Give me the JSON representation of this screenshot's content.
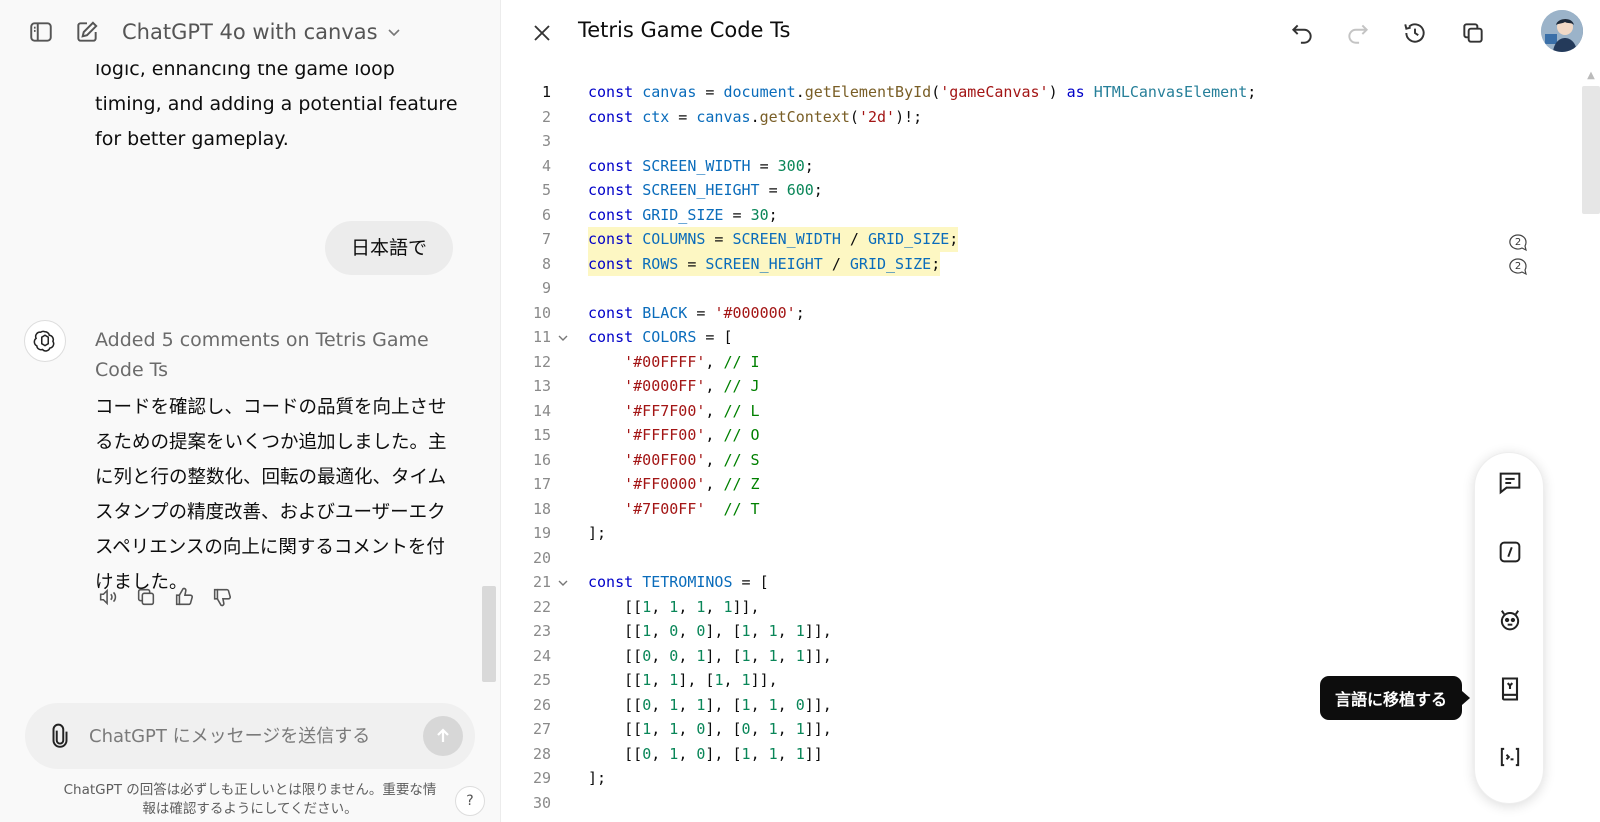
{
  "left_header": {
    "model_title": "ChatGPT 4o with canvas"
  },
  "conversation": {
    "previous_message_tail": "logic, enhancing the game loop timing, and adding a potential feature for better gameplay.",
    "user_message": "日本語で",
    "assistant_status": "Added 5 comments on Tetris Game Code Ts",
    "assistant_text": "コードを確認し、コードの品質を向上させるための提案をいくつか追加しました。主に列と行の整数化、回転の最適化、タイムスタンプの精度改善、およびユーザーエクスペリエンスの向上に関するコメントを付けました。"
  },
  "composer": {
    "placeholder": "ChatGPT にメッセージを送信する"
  },
  "disclaimer": "ChatGPT の回答は必ずしも正しいとは限りません。重要な情報は確認するようにしてください。",
  "help_label": "?",
  "canvas": {
    "title": "Tetris Game Code Ts",
    "comment_counts": [
      "2",
      "2"
    ],
    "tooltip": "言語に移植する"
  },
  "code_lines": [
    {
      "n": "1",
      "tokens": [
        [
          "kw",
          "const "
        ],
        [
          "var",
          "canvas"
        ],
        [
          "p",
          " = "
        ],
        [
          "var",
          "document"
        ],
        [
          "p",
          "."
        ],
        [
          "fn",
          "getElementById"
        ],
        [
          "p",
          "("
        ],
        [
          "str",
          "'gameCanvas'"
        ],
        [
          "p",
          ") "
        ],
        [
          "kw",
          "as "
        ],
        [
          "ty",
          "HTMLCanvasElement"
        ],
        [
          "p",
          ";"
        ]
      ]
    },
    {
      "n": "2",
      "tokens": [
        [
          "kw",
          "const "
        ],
        [
          "var",
          "ctx"
        ],
        [
          "p",
          " = "
        ],
        [
          "var",
          "canvas"
        ],
        [
          "p",
          "."
        ],
        [
          "fn",
          "getContext"
        ],
        [
          "p",
          "("
        ],
        [
          "str",
          "'2d'"
        ],
        [
          "p",
          ")!;"
        ]
      ]
    },
    {
      "n": "3",
      "tokens": []
    },
    {
      "n": "4",
      "tokens": [
        [
          "kw",
          "const "
        ],
        [
          "var",
          "SCREEN_WIDTH"
        ],
        [
          "p",
          " = "
        ],
        [
          "num",
          "300"
        ],
        [
          "p",
          ";"
        ]
      ]
    },
    {
      "n": "5",
      "tokens": [
        [
          "kw",
          "const "
        ],
        [
          "var",
          "SCREEN_HEIGHT"
        ],
        [
          "p",
          " = "
        ],
        [
          "num",
          "600"
        ],
        [
          "p",
          ";"
        ]
      ]
    },
    {
      "n": "6",
      "tokens": [
        [
          "kw",
          "const "
        ],
        [
          "var",
          "GRID_SIZE"
        ],
        [
          "p",
          " = "
        ],
        [
          "num",
          "30"
        ],
        [
          "p",
          ";"
        ]
      ]
    },
    {
      "n": "7",
      "hl": true,
      "tokens": [
        [
          "kw",
          "const "
        ],
        [
          "var",
          "COLUMNS"
        ],
        [
          "p",
          " = "
        ],
        [
          "var",
          "SCREEN_WIDTH"
        ],
        [
          "p",
          " / "
        ],
        [
          "var",
          "GRID_SIZE"
        ],
        [
          "p",
          ";"
        ]
      ]
    },
    {
      "n": "8",
      "hl": true,
      "tokens": [
        [
          "kw",
          "const "
        ],
        [
          "var",
          "ROWS"
        ],
        [
          "p",
          " = "
        ],
        [
          "var",
          "SCREEN_HEIGHT"
        ],
        [
          "p",
          " / "
        ],
        [
          "var",
          "GRID_SIZE"
        ],
        [
          "p",
          ";"
        ]
      ]
    },
    {
      "n": "9",
      "tokens": []
    },
    {
      "n": "10",
      "tokens": [
        [
          "kw",
          "const "
        ],
        [
          "var",
          "BLACK"
        ],
        [
          "p",
          " = "
        ],
        [
          "str",
          "'#000000'"
        ],
        [
          "p",
          ";"
        ]
      ]
    },
    {
      "n": "11",
      "fold": true,
      "tokens": [
        [
          "kw",
          "const "
        ],
        [
          "var",
          "COLORS"
        ],
        [
          "p",
          " = ["
        ]
      ]
    },
    {
      "n": "12",
      "tokens": [
        [
          "p",
          "    "
        ],
        [
          "str",
          "'#00FFFF'"
        ],
        [
          "p",
          ", "
        ],
        [
          "cm",
          "// I"
        ]
      ]
    },
    {
      "n": "13",
      "tokens": [
        [
          "p",
          "    "
        ],
        [
          "str",
          "'#0000FF'"
        ],
        [
          "p",
          ", "
        ],
        [
          "cm",
          "// J"
        ]
      ]
    },
    {
      "n": "14",
      "tokens": [
        [
          "p",
          "    "
        ],
        [
          "str",
          "'#FF7F00'"
        ],
        [
          "p",
          ", "
        ],
        [
          "cm",
          "// L"
        ]
      ]
    },
    {
      "n": "15",
      "tokens": [
        [
          "p",
          "    "
        ],
        [
          "str",
          "'#FFFF00'"
        ],
        [
          "p",
          ", "
        ],
        [
          "cm",
          "// O"
        ]
      ]
    },
    {
      "n": "16",
      "tokens": [
        [
          "p",
          "    "
        ],
        [
          "str",
          "'#00FF00'"
        ],
        [
          "p",
          ", "
        ],
        [
          "cm",
          "// S"
        ]
      ]
    },
    {
      "n": "17",
      "tokens": [
        [
          "p",
          "    "
        ],
        [
          "str",
          "'#FF0000'"
        ],
        [
          "p",
          ", "
        ],
        [
          "cm",
          "// Z"
        ]
      ]
    },
    {
      "n": "18",
      "tokens": [
        [
          "p",
          "    "
        ],
        [
          "str",
          "'#7F00FF'"
        ],
        [
          "p",
          "  "
        ],
        [
          "cm",
          "// T"
        ]
      ]
    },
    {
      "n": "19",
      "tokens": [
        [
          "p",
          "];"
        ]
      ]
    },
    {
      "n": "20",
      "tokens": []
    },
    {
      "n": "21",
      "fold": true,
      "tokens": [
        [
          "kw",
          "const "
        ],
        [
          "var",
          "TETROMINOS"
        ],
        [
          "p",
          " = ["
        ]
      ]
    },
    {
      "n": "22",
      "tokens": [
        [
          "p",
          "    [["
        ],
        [
          "num",
          "1"
        ],
        [
          "p",
          ", "
        ],
        [
          "num",
          "1"
        ],
        [
          "p",
          ", "
        ],
        [
          "num",
          "1"
        ],
        [
          "p",
          ", "
        ],
        [
          "num",
          "1"
        ],
        [
          "p",
          "]],"
        ]
      ]
    },
    {
      "n": "23",
      "tokens": [
        [
          "p",
          "    [["
        ],
        [
          "num",
          "1"
        ],
        [
          "p",
          ", "
        ],
        [
          "num",
          "0"
        ],
        [
          "p",
          ", "
        ],
        [
          "num",
          "0"
        ],
        [
          "p",
          "], ["
        ],
        [
          "num",
          "1"
        ],
        [
          "p",
          ", "
        ],
        [
          "num",
          "1"
        ],
        [
          "p",
          ", "
        ],
        [
          "num",
          "1"
        ],
        [
          "p",
          "]],"
        ]
      ]
    },
    {
      "n": "24",
      "tokens": [
        [
          "p",
          "    [["
        ],
        [
          "num",
          "0"
        ],
        [
          "p",
          ", "
        ],
        [
          "num",
          "0"
        ],
        [
          "p",
          ", "
        ],
        [
          "num",
          "1"
        ],
        [
          "p",
          "], ["
        ],
        [
          "num",
          "1"
        ],
        [
          "p",
          ", "
        ],
        [
          "num",
          "1"
        ],
        [
          "p",
          ", "
        ],
        [
          "num",
          "1"
        ],
        [
          "p",
          "]],"
        ]
      ]
    },
    {
      "n": "25",
      "tokens": [
        [
          "p",
          "    [["
        ],
        [
          "num",
          "1"
        ],
        [
          "p",
          ", "
        ],
        [
          "num",
          "1"
        ],
        [
          "p",
          "], ["
        ],
        [
          "num",
          "1"
        ],
        [
          "p",
          ", "
        ],
        [
          "num",
          "1"
        ],
        [
          "p",
          "]],"
        ]
      ]
    },
    {
      "n": "26",
      "tokens": [
        [
          "p",
          "    [["
        ],
        [
          "num",
          "0"
        ],
        [
          "p",
          ", "
        ],
        [
          "num",
          "1"
        ],
        [
          "p",
          ", "
        ],
        [
          "num",
          "1"
        ],
        [
          "p",
          "], ["
        ],
        [
          "num",
          "1"
        ],
        [
          "p",
          ", "
        ],
        [
          "num",
          "1"
        ],
        [
          "p",
          ", "
        ],
        [
          "num",
          "0"
        ],
        [
          "p",
          "]],"
        ]
      ]
    },
    {
      "n": "27",
      "tokens": [
        [
          "p",
          "    [["
        ],
        [
          "num",
          "1"
        ],
        [
          "p",
          ", "
        ],
        [
          "num",
          "1"
        ],
        [
          "p",
          ", "
        ],
        [
          "num",
          "0"
        ],
        [
          "p",
          "], ["
        ],
        [
          "num",
          "0"
        ],
        [
          "p",
          ", "
        ],
        [
          "num",
          "1"
        ],
        [
          "p",
          ", "
        ],
        [
          "num",
          "1"
        ],
        [
          "p",
          "]],"
        ]
      ]
    },
    {
      "n": "28",
      "tokens": [
        [
          "p",
          "    [["
        ],
        [
          "num",
          "0"
        ],
        [
          "p",
          ", "
        ],
        [
          "num",
          "1"
        ],
        [
          "p",
          ", "
        ],
        [
          "num",
          "0"
        ],
        [
          "p",
          "], ["
        ],
        [
          "num",
          "1"
        ],
        [
          "p",
          ", "
        ],
        [
          "num",
          "1"
        ],
        [
          "p",
          ", "
        ],
        [
          "num",
          "1"
        ],
        [
          "p",
          "]]"
        ]
      ]
    },
    {
      "n": "29",
      "tokens": [
        [
          "p",
          "];"
        ]
      ]
    },
    {
      "n": "30",
      "tokens": []
    }
  ]
}
